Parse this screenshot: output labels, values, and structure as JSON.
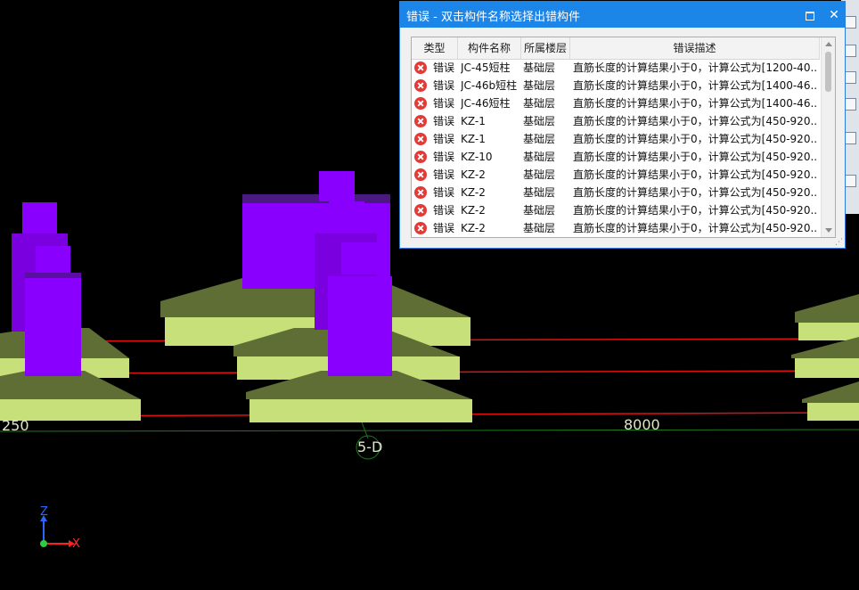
{
  "viewport": {
    "dimension_left": "250",
    "dimension_right": "8000",
    "grid_label": "5-D",
    "axis_x": "X",
    "axis_z": "Z",
    "colors": {
      "column": "#8a00ff",
      "footing": "#c8e07a",
      "axis_line": "#e01010",
      "grid_line": "#1d7a1d"
    }
  },
  "dialog": {
    "title": "错误 - 双击构件名称选择出错构件",
    "maximize_icon": "maximize-icon",
    "close_icon": "close-icon",
    "columns": [
      "类型",
      "构件名称",
      "所属楼层",
      "错误描述"
    ],
    "rows": [
      {
        "type": "错误",
        "name": "JC-45短柱",
        "floor": "基础层",
        "desc": "直筋长度的计算结果小于0，计算公式为[1200-40..."
      },
      {
        "type": "错误",
        "name": "JC-46b短柱",
        "floor": "基础层",
        "desc": "直筋长度的计算结果小于0，计算公式为[1400-46..."
      },
      {
        "type": "错误",
        "name": "JC-46短柱",
        "floor": "基础层",
        "desc": "直筋长度的计算结果小于0，计算公式为[1400-46..."
      },
      {
        "type": "错误",
        "name": "KZ-1",
        "floor": "基础层",
        "desc": "直筋长度的计算结果小于0，计算公式为[450-920..."
      },
      {
        "type": "错误",
        "name": "KZ-1",
        "floor": "基础层",
        "desc": "直筋长度的计算结果小于0，计算公式为[450-920..."
      },
      {
        "type": "错误",
        "name": "KZ-10",
        "floor": "基础层",
        "desc": "直筋长度的计算结果小于0，计算公式为[450-920..."
      },
      {
        "type": "错误",
        "name": "KZ-2",
        "floor": "基础层",
        "desc": "直筋长度的计算结果小于0，计算公式为[450-920..."
      },
      {
        "type": "错误",
        "name": "KZ-2",
        "floor": "基础层",
        "desc": "直筋长度的计算结果小于0，计算公式为[450-920..."
      },
      {
        "type": "错误",
        "name": "KZ-2",
        "floor": "基础层",
        "desc": "直筋长度的计算结果小于0，计算公式为[450-920..."
      },
      {
        "type": "错误",
        "name": "KZ-2",
        "floor": "基础层",
        "desc": "直筋长度的计算结果小于0，计算公式为[450-920..."
      }
    ]
  }
}
